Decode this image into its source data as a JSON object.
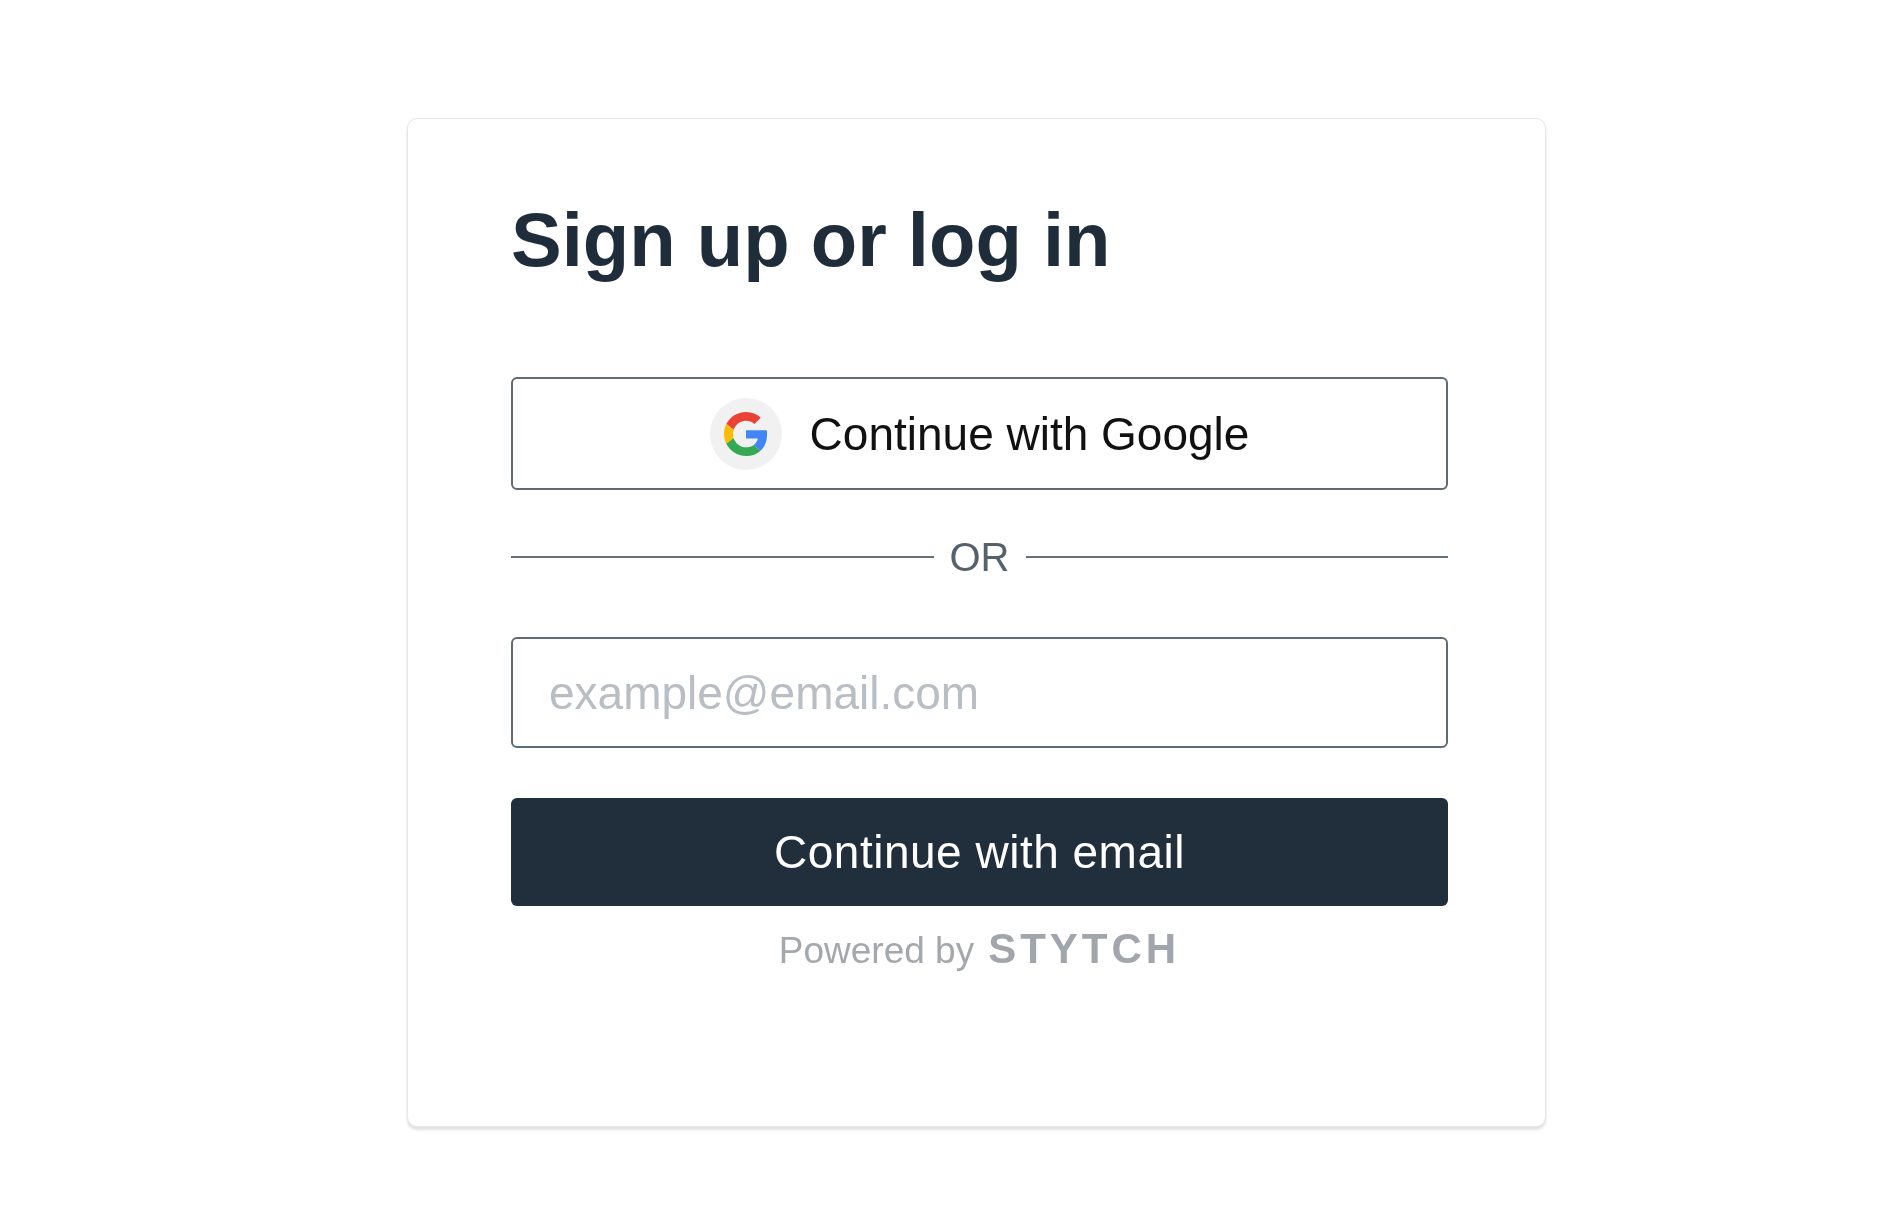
{
  "title": "Sign up or log in",
  "google_button": {
    "label": "Continue with Google"
  },
  "divider": {
    "text": "OR"
  },
  "email_field": {
    "placeholder": "example@email.com"
  },
  "email_button": {
    "label": "Continue with email"
  },
  "footer": {
    "text": "Powered by",
    "brand": "STYTCH"
  }
}
